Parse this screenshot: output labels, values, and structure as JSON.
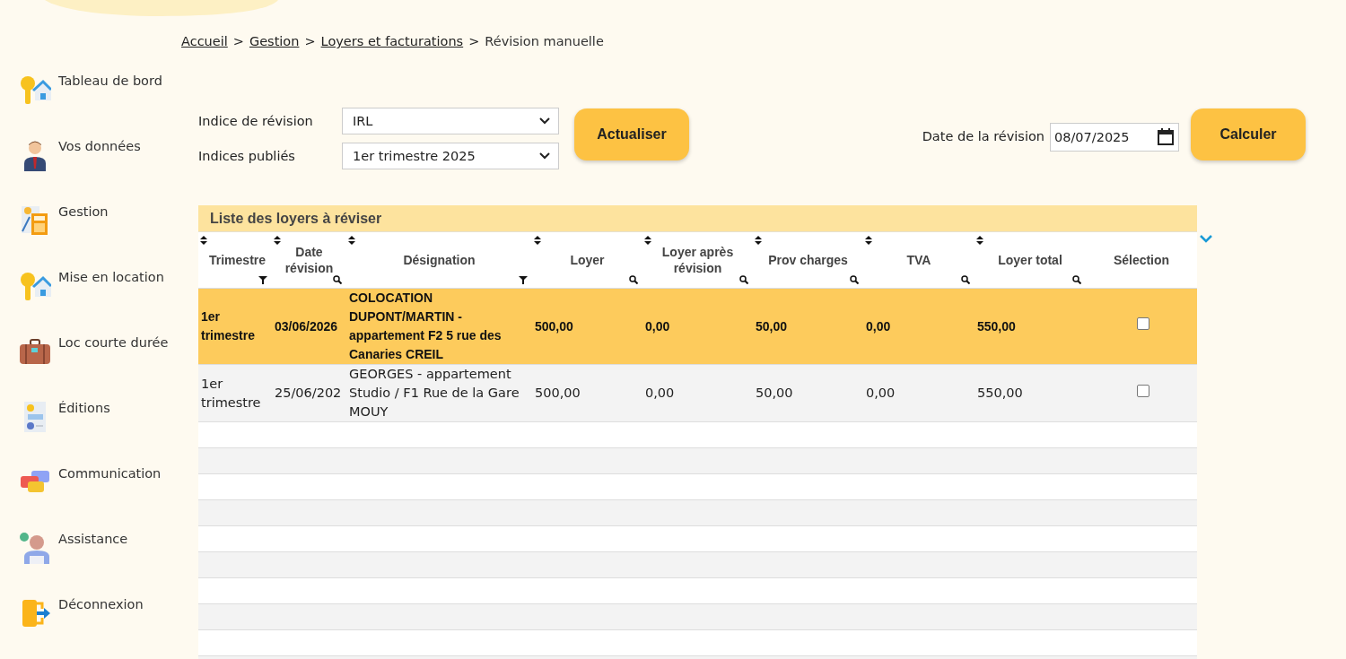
{
  "breadcrumb": [
    {
      "label": "Accueil",
      "link": true
    },
    {
      "label": "Gestion",
      "link": true
    },
    {
      "label": "Loyers et facturations",
      "link": true
    },
    {
      "label": "Révision manuelle",
      "link": false
    }
  ],
  "breadcrumb_separator": ">",
  "sidebar": {
    "items": [
      {
        "label": "Tableau de bord",
        "kind": "keyhouse"
      },
      {
        "label": "Vos données",
        "kind": "person"
      },
      {
        "label": "Gestion",
        "kind": "calculator"
      },
      {
        "label": "Mise en location",
        "kind": "keyhouse"
      },
      {
        "label": "Loc courte durée",
        "kind": "suitcase"
      },
      {
        "label": "Éditions",
        "kind": "report"
      },
      {
        "label": "Communication",
        "kind": "chat"
      },
      {
        "label": "Assistance",
        "kind": "support"
      },
      {
        "label": "Déconnexion",
        "kind": "logout"
      }
    ]
  },
  "form": {
    "fields": [
      {
        "label": "Indice de révision",
        "value": "IRL"
      },
      {
        "label": "Indices publiés",
        "value": "1er trimestre 2025"
      }
    ],
    "refresh_button": "Actualiser",
    "date_label": "Date de la révision",
    "date_value": "08/07/2025",
    "calculate_button": "Calculer"
  },
  "table": {
    "title": "Liste des loyers à réviser",
    "columns": [
      {
        "label": "Trimestre",
        "sortable": true,
        "kind": "funnel"
      },
      {
        "label": "Date révision",
        "sortable": true,
        "kind": "search"
      },
      {
        "label": "Désignation",
        "sortable": true,
        "kind": "funnel"
      },
      {
        "label": "Loyer",
        "sortable": true,
        "kind": "search"
      },
      {
        "label": "Loyer après révision",
        "sortable": true,
        "kind": "search"
      },
      {
        "label": "Prov charges",
        "sortable": true,
        "kind": "search"
      },
      {
        "label": "TVA",
        "sortable": true,
        "kind": "search"
      },
      {
        "label": "Loyer total",
        "sortable": true,
        "kind": "search"
      },
      {
        "label": "Sélection",
        "sortable": false,
        "kind": "plain"
      }
    ],
    "rows": [
      {
        "selected": true,
        "cells": [
          "1er trimestre",
          "03/06/2026",
          "COLOCATION DUPONT/MARTIN - appartement F2 5 rue des Canaries CREIL",
          "500,00",
          "0,00",
          "50,00",
          "0,00",
          "550,00"
        ],
        "checked": false
      },
      {
        "selected": false,
        "cells": [
          "1er trimestre",
          "25/06/202",
          "GEORGES - appartement Studio / F1 Rue de la Gare MOUY",
          "500,00",
          "0,00",
          "50,00",
          "0,00",
          "550,00"
        ],
        "checked": false
      }
    ]
  }
}
